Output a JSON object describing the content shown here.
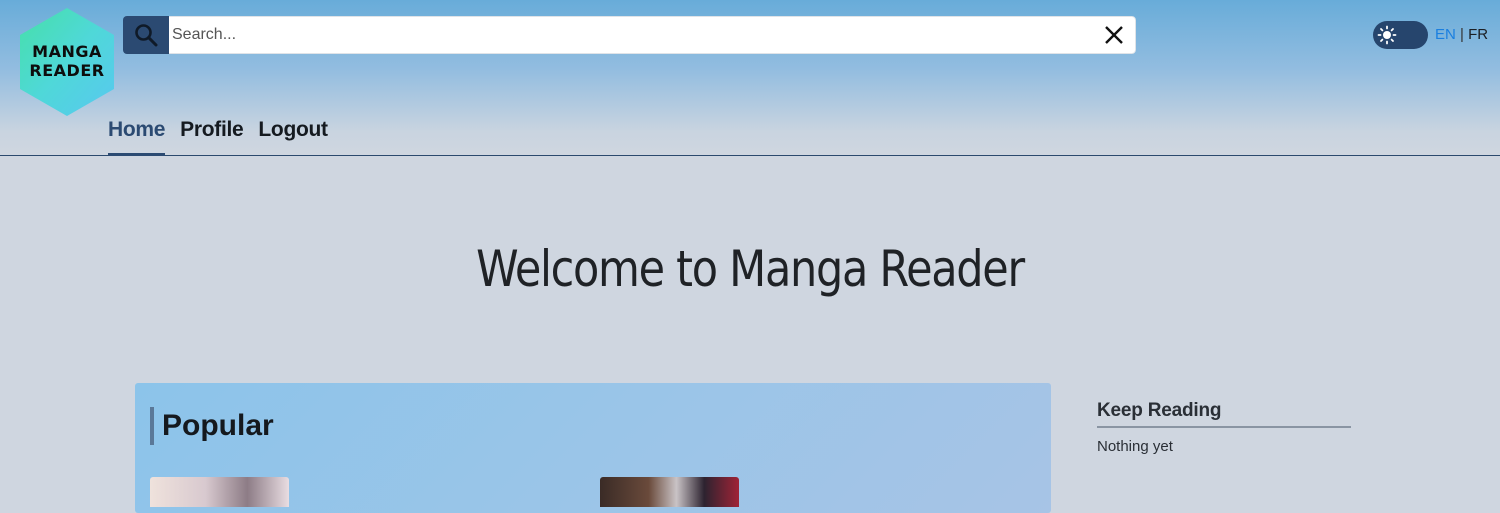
{
  "logo": {
    "text_line1": "MANGA",
    "text_line2": "READER"
  },
  "search": {
    "placeholder": "Search...",
    "value": ""
  },
  "icons": {
    "search": "search-icon",
    "clear": "close-icon",
    "theme": "sun-icon"
  },
  "language": {
    "en": "EN",
    "separator": " | ",
    "fr": "FR",
    "active": "EN"
  },
  "nav": [
    {
      "label": "Home",
      "active": true
    },
    {
      "label": "Profile",
      "active": false
    },
    {
      "label": "Logout",
      "active": false
    }
  ],
  "main": {
    "welcome_title": "Welcome to Manga Reader"
  },
  "popular": {
    "title": "Popular"
  },
  "keep_reading": {
    "title": "Keep Reading",
    "empty_text": "Nothing yet"
  },
  "colors": {
    "accent": "#2b4a72",
    "language_active": "#1a7fe0",
    "background": "#cfd6e0"
  }
}
